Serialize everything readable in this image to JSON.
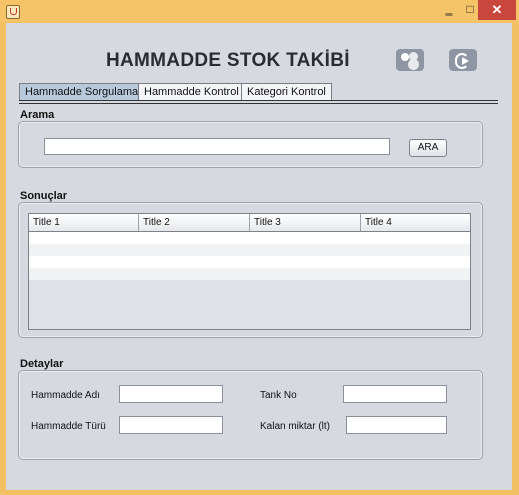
{
  "window": {
    "minimize_glyph": "‗",
    "maximize_glyph": "□",
    "close_glyph": "✕"
  },
  "header": {
    "title": "HAMMADDE STOK TAKİBİ"
  },
  "tabs": [
    {
      "label": "Hammadde Sorgulama",
      "active": true
    },
    {
      "label": "Hammadde Kontrol",
      "active": false
    },
    {
      "label": "Kategori Kontrol",
      "active": false
    }
  ],
  "search": {
    "section_label": "Arama",
    "value": "",
    "placeholder": "",
    "button_label": "ARA"
  },
  "results": {
    "section_label": "Sonuçlar",
    "columns": [
      "Title 1",
      "Title 2",
      "Title 3",
      "Title 4"
    ],
    "rows": [
      [
        "",
        "",
        "",
        ""
      ],
      [
        "",
        "",
        "",
        ""
      ],
      [
        "",
        "",
        "",
        ""
      ],
      [
        "",
        "",
        "",
        ""
      ]
    ]
  },
  "details": {
    "section_label": "Detaylar",
    "fields": {
      "name_label": "Hammadde Adı",
      "name_value": "",
      "type_label": "Hammadde Türü",
      "type_value": "",
      "tank_label": "Tank No",
      "tank_value": "",
      "remaining_label": "Kalan miktar (lt)",
      "remaining_value": ""
    }
  },
  "colors": {
    "titlebar": "#f4c466",
    "close_button": "#c9463d",
    "content_bg": "#d7d9e0",
    "active_tab": "#b8c9dc"
  },
  "icons": {
    "app": "java-cup-icon",
    "users": "users-icon",
    "logout": "logout-icon"
  }
}
